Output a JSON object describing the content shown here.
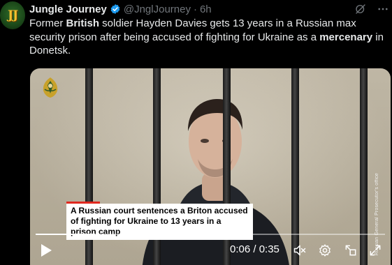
{
  "avatar": {
    "text": "JJ"
  },
  "tweet": {
    "author_name": "Jungle Journey",
    "handle": "@JnglJourney",
    "separator": "·",
    "time": "6h",
    "text_parts": [
      {
        "t": "Former ",
        "bold": false
      },
      {
        "t": "British",
        "bold": true
      },
      {
        "t": " soldier Hayden Davies gets 13 years in a Russian max security prison after being accused of fighting for Ukraine as a ",
        "bold": false
      },
      {
        "t": "mercenary",
        "bold": true
      },
      {
        "t": " in Donetsk.",
        "bold": false
      }
    ]
  },
  "video": {
    "caption": "A Russian court sentences a Briton accused of fighting for Ukraine to 13 years in a prison camp",
    "side_caption": "Russian General Prosecutor's office",
    "time_display": "0:06 / 0:35",
    "progress_fraction": 0.17,
    "icons": [
      "play-icon",
      "mute-icon",
      "settings-icon",
      "fullscreen-toggle-icon",
      "expand-icon"
    ]
  },
  "colors": {
    "background": "#000000",
    "text": "#e7e9ea",
    "muted": "#71767b",
    "verified": "#1d9bf0",
    "caption_accent": "#e0281e"
  }
}
